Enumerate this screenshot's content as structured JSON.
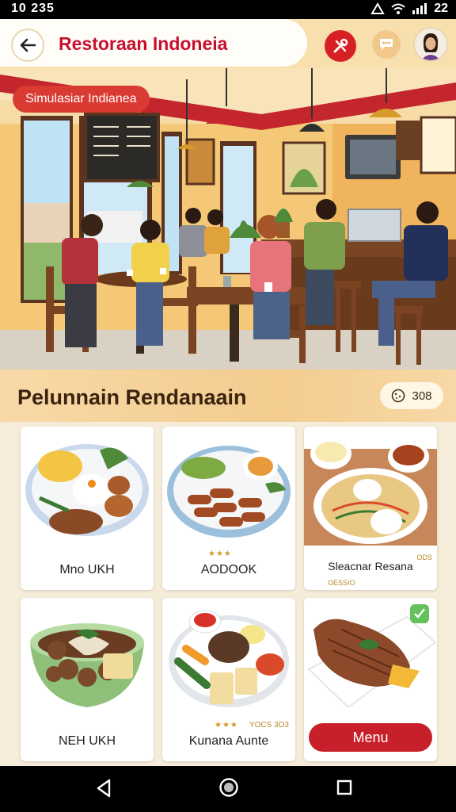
{
  "status": {
    "time": "10 235",
    "battery": "22"
  },
  "header": {
    "title": "Restoraan Indoneia"
  },
  "hero": {
    "badge": "Simulasiar Indianea"
  },
  "section": {
    "title": "Pelunnain Rendanaain",
    "count": "308"
  },
  "cards": [
    {
      "label": "Mno UKH",
      "rating": "",
      "sub": ""
    },
    {
      "label": "AODOOK",
      "rating": "★★★",
      "sub": ""
    },
    {
      "label": "Sleacnar Resana",
      "rating": "",
      "sub": "OESSIO",
      "note": "ODS"
    },
    {
      "label": "NEH UKH",
      "rating": "",
      "sub": ""
    },
    {
      "label": "Kunana Aunte",
      "rating": "★★★ ",
      "sub": "",
      "note": "YOCS 3O3"
    },
    {
      "label": "",
      "button": "Menu"
    }
  ],
  "colors": {
    "accent": "#c8102e",
    "cream": "#f6ecda",
    "wall": "#f2c56a"
  },
  "icons": [
    "back-arrow-icon",
    "tools-icon",
    "chat-icon",
    "avatar-icon",
    "back-triangle-icon",
    "home-circle-icon",
    "recents-square-icon"
  ]
}
